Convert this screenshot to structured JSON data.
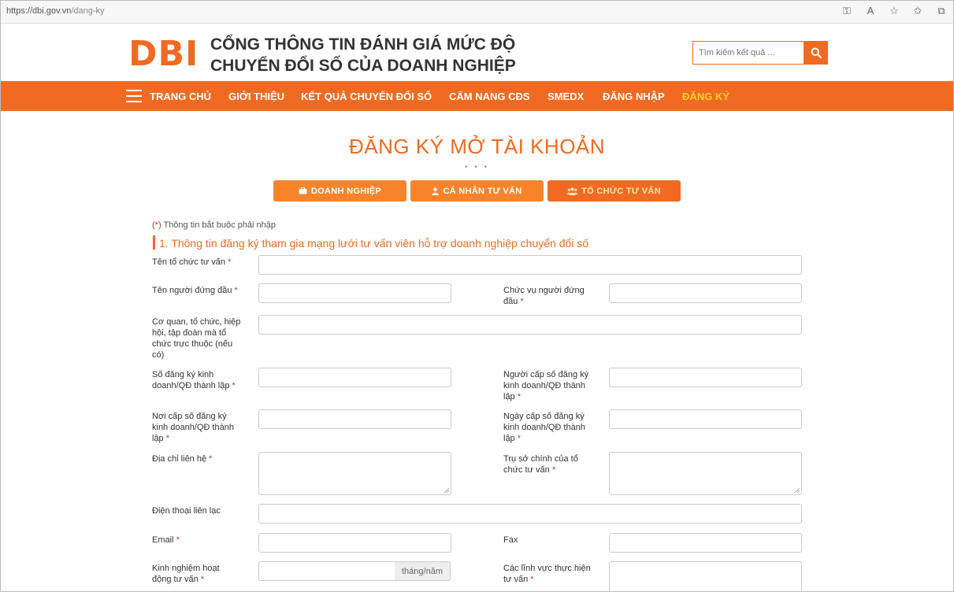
{
  "browser": {
    "url_host": "https://dbi.gov.vn",
    "url_path": "/dang-ky"
  },
  "header": {
    "logo": "DBI",
    "title_line1": "CỔNG THÔNG TIN ĐÁNH GIÁ MỨC ĐỘ",
    "title_line2": "CHUYỂN ĐỔI SỐ CỦA DOANH NGHIỆP",
    "search_placeholder": "Tìm kiếm kết quả ..."
  },
  "nav": {
    "items": [
      {
        "label": "TRANG CHỦ"
      },
      {
        "label": "GIỚI THIỆU"
      },
      {
        "label": "KẾT QUẢ CHUYỂN ĐỔI SỐ"
      },
      {
        "label": "CẨM NANG CĐS"
      },
      {
        "label": "SMEDX"
      },
      {
        "label": "ĐĂNG NHẬP"
      },
      {
        "label": "ĐĂNG KÝ"
      }
    ]
  },
  "page": {
    "title": "ĐĂNG KÝ MỞ TÀI KHOẢN",
    "dots": "• • •",
    "tabs": [
      {
        "label": "DOANH NGHIỆP",
        "icon": "briefcase-icon"
      },
      {
        "label": "CÁ NHÂN TƯ VẤN",
        "icon": "user-icon"
      },
      {
        "label": "TỔ CHỨC TƯ VẤN",
        "icon": "users-icon"
      }
    ],
    "required_star": "(*)",
    "required_note": " Thông tin bắt buộc phải nhập",
    "section_title": "1. Thông tin đăng ký tham gia mạng lưới tư vấn viên hỗ trợ doanh nghiệp chuyển đổi số"
  },
  "form": {
    "org_name": "Tên tổ chức tư vấn",
    "leader_name": "Tên người đứng đầu",
    "leader_position": "Chức vụ người đứng đầu",
    "parent_org": "Cơ quan, tổ chức, hiệp hội, tập đoàn mà tổ chức trực thuộc (nếu có)",
    "reg_number": "Số đăng ký kinh doanh/QĐ thành lập",
    "reg_issuer": "Người cấp số đăng ký kinh doanh/QĐ thành lập",
    "reg_place": "Nơi cấp số đăng ký kinh doanh/QĐ thành lập",
    "reg_date": "Ngày cấp số đăng ký kinh doanh/QĐ thành lập",
    "address": "Địa chỉ liên hệ",
    "head_office": "Trụ sở chính của tổ chức tư vấn",
    "phone": "Điện thoại liên lạc",
    "email": "Email",
    "fax": "Fax",
    "experience": "Kinh nghiệm hoạt động tư vấn",
    "experience_unit": "tháng/năm",
    "fields": "Các lĩnh vực thực hiện tư vấn",
    "req_mark": "*"
  },
  "colors": {
    "brand": "#f26a21",
    "nav_active": "#ffd12a"
  }
}
